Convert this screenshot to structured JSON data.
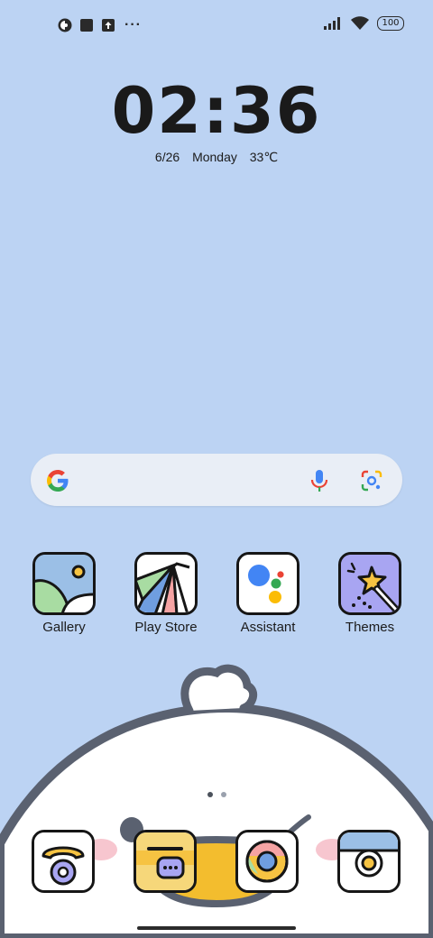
{
  "status_bar": {
    "left_icons": [
      "app-notification-icon",
      "square-notification-icon",
      "upload-icon",
      "more-dots-icon"
    ],
    "more_text": "···",
    "right_icons": [
      "signal-icon",
      "wifi-icon",
      "battery-icon"
    ],
    "battery_level": "100"
  },
  "lock_widget": {
    "time": "02:36",
    "date": "6/26",
    "weekday": "Monday",
    "temperature": "33℃"
  },
  "search_bar": {
    "icons": [
      "google-g-icon",
      "microphone-icon",
      "google-lens-icon"
    ]
  },
  "apps": [
    {
      "label": "Gallery",
      "icon": "gallery-icon"
    },
    {
      "label": "Play Store",
      "icon": "play-store-icon"
    },
    {
      "label": "Assistant",
      "icon": "assistant-icon"
    },
    {
      "label": "Themes",
      "icon": "themes-icon"
    }
  ],
  "page_indicator": {
    "pages": 2,
    "current": 1
  },
  "dock": [
    {
      "icon": "phone-icon"
    },
    {
      "icon": "messages-icon"
    },
    {
      "icon": "chrome-icon"
    },
    {
      "icon": "camera-icon"
    }
  ],
  "colors": {
    "wallpaper": "#bcd3f3",
    "search_bar": "#e9eef6",
    "icon_outline": "#161616"
  }
}
